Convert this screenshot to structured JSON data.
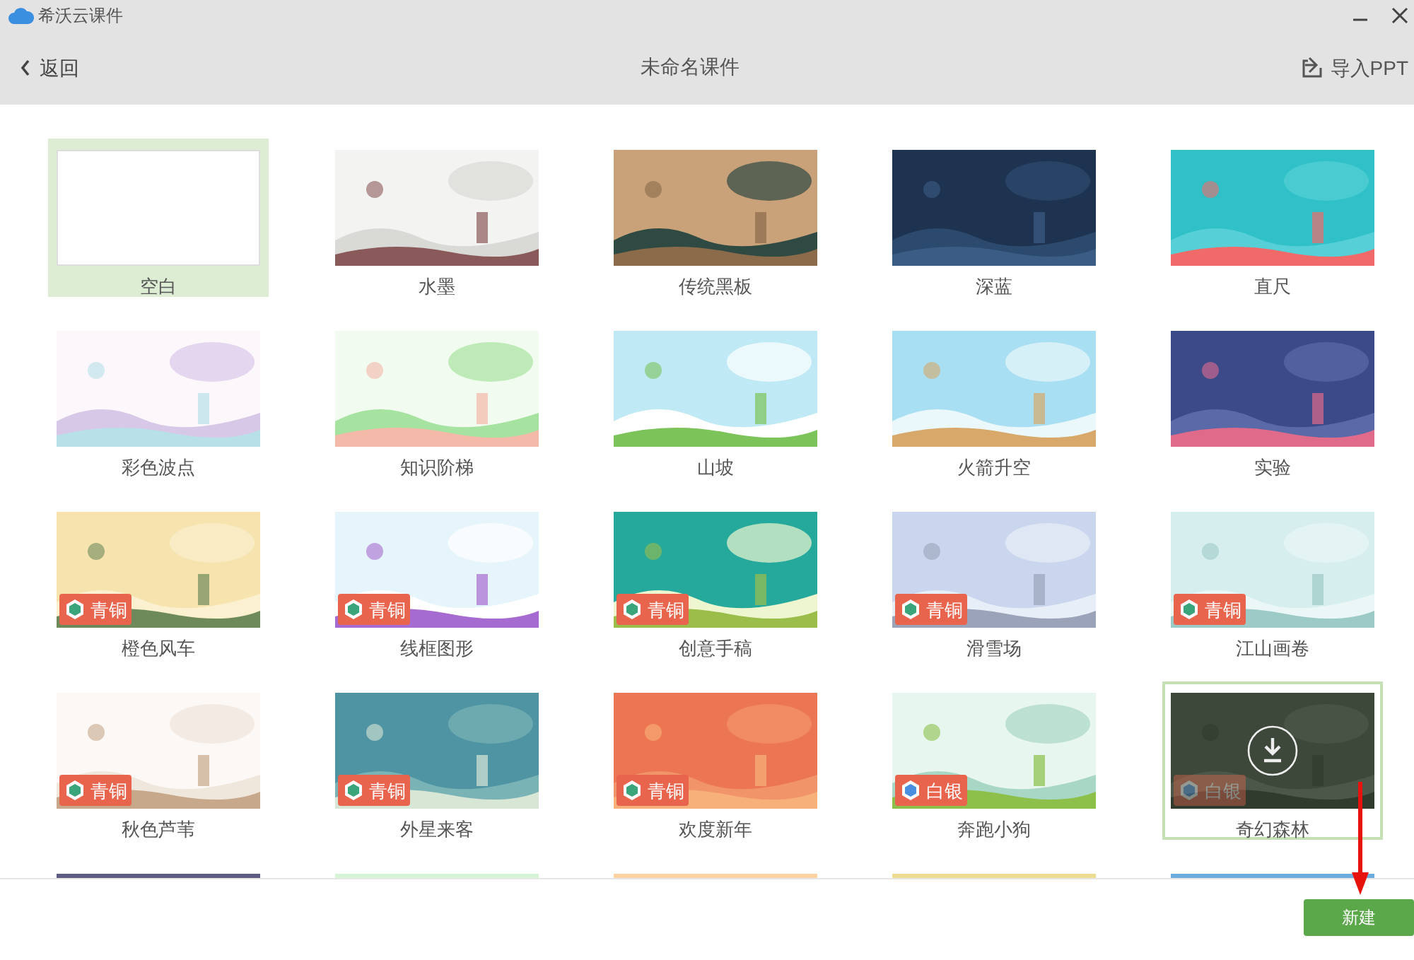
{
  "window": {
    "title": "希沃云课件"
  },
  "nav": {
    "back": "返回",
    "title": "未命名课件",
    "import": "导入PPT"
  },
  "templates": [
    {
      "name": "空白",
      "selected": true,
      "hovered": false
    },
    {
      "name": "水墨",
      "selected": false,
      "hovered": false
    },
    {
      "name": "传统黑板",
      "selected": false,
      "hovered": false
    },
    {
      "name": "深蓝",
      "selected": false,
      "hovered": false
    },
    {
      "name": "直尺",
      "selected": false,
      "hovered": false
    },
    {
      "name": "彩色波点",
      "selected": false,
      "hovered": false
    },
    {
      "name": "知识阶梯",
      "selected": false,
      "hovered": false
    },
    {
      "name": "山坡",
      "selected": false,
      "hovered": false
    },
    {
      "name": "火箭升空",
      "selected": false,
      "hovered": false
    },
    {
      "name": "实验",
      "selected": false,
      "hovered": false
    },
    {
      "name": "橙色风车",
      "selected": false,
      "hovered": false,
      "badge": {
        "kind": "bronze",
        "label": "青铜"
      }
    },
    {
      "name": "线框图形",
      "selected": false,
      "hovered": false,
      "badge": {
        "kind": "bronze",
        "label": "青铜"
      }
    },
    {
      "name": "创意手稿",
      "selected": false,
      "hovered": false,
      "badge": {
        "kind": "bronze",
        "label": "青铜"
      }
    },
    {
      "name": "滑雪场",
      "selected": false,
      "hovered": false,
      "badge": {
        "kind": "bronze",
        "label": "青铜"
      }
    },
    {
      "name": "江山画卷",
      "selected": false,
      "hovered": false,
      "badge": {
        "kind": "bronze",
        "label": "青铜"
      }
    },
    {
      "name": "秋色芦苇",
      "selected": false,
      "hovered": false,
      "badge": {
        "kind": "bronze",
        "label": "青铜"
      }
    },
    {
      "name": "外星来客",
      "selected": false,
      "hovered": false,
      "badge": {
        "kind": "bronze",
        "label": "青铜"
      }
    },
    {
      "name": "欢度新年",
      "selected": false,
      "hovered": false,
      "badge": {
        "kind": "bronze",
        "label": "青铜"
      }
    },
    {
      "name": "奔跑小狗",
      "selected": false,
      "hovered": false,
      "badge": {
        "kind": "silver",
        "label": "白银"
      }
    },
    {
      "name": "奇幻森林",
      "selected": false,
      "hovered": true,
      "badge": {
        "kind": "silver",
        "label": "白银"
      }
    }
  ],
  "footer": {
    "create": "新建"
  }
}
